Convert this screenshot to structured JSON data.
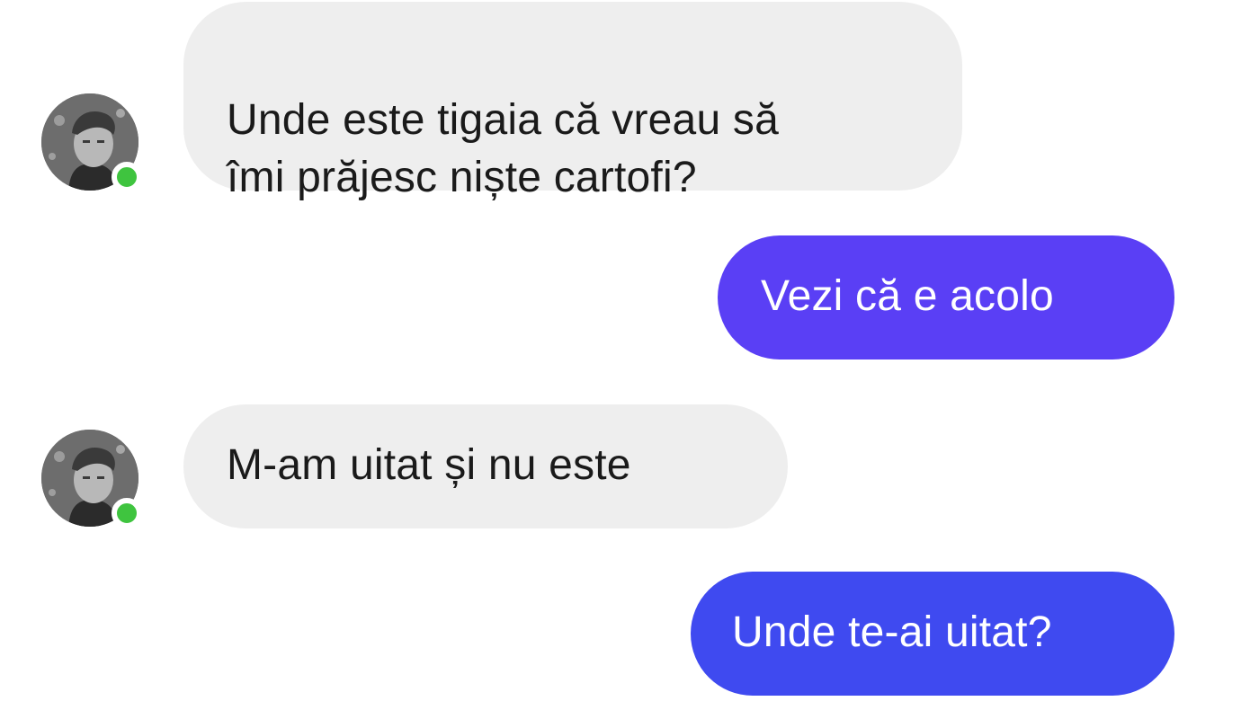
{
  "colors": {
    "incoming_bubble": "#eeeeee",
    "outgoing_bubble_1": "#5a3ff5",
    "outgoing_bubble_2": "#3f4af0",
    "online_indicator": "#3fc43f"
  },
  "messages": [
    {
      "direction": "incoming",
      "text": "Unde este tigaia că vreau să\nîmi prăjesc niște cartofi?",
      "avatar": "contact-avatar",
      "online": true
    },
    {
      "direction": "outgoing",
      "text": "Vezi că e acolo"
    },
    {
      "direction": "incoming",
      "text": "M-am uitat și nu este",
      "avatar": "contact-avatar",
      "online": true
    },
    {
      "direction": "outgoing",
      "text": "Unde te-ai uitat?"
    }
  ]
}
